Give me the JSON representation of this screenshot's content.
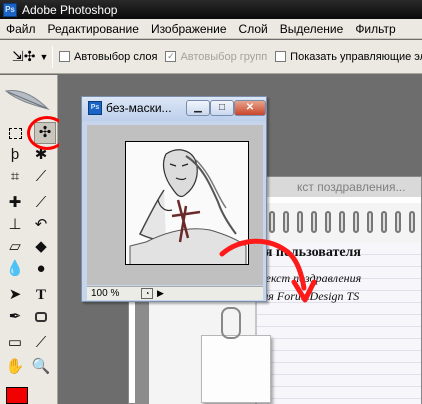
{
  "app": {
    "title": "Adobe Photoshop",
    "icon": "photoshop-app-icon"
  },
  "menu": {
    "items": [
      "Файл",
      "Редактирование",
      "Изображение",
      "Слой",
      "Выделение",
      "Фильтр"
    ]
  },
  "options_bar": {
    "tool_icon": "move-tool-icon",
    "dropdown_icon": "chevron-down-icon",
    "checkboxes": [
      {
        "label": "Автовыбор слоя",
        "checked": false,
        "enabled": true
      },
      {
        "label": "Автовыбор групп",
        "checked": true,
        "enabled": false
      },
      {
        "label": "Показать управляющие эле",
        "checked": false,
        "enabled": true
      }
    ]
  },
  "toolbox": {
    "tools": [
      "marquee-tool-icon",
      "move-tool-icon",
      "lasso-tool-icon",
      "magic-wand-tool-icon",
      "crop-tool-icon",
      "eyedropper-slice-tool-icon",
      "healing-brush-tool-icon",
      "brush-tool-icon",
      "clone-stamp-tool-icon",
      "history-brush-tool-icon",
      "eraser-tool-icon",
      "paint-bucket-tool-icon",
      "blur-tool-icon",
      "dodge-tool-icon",
      "path-selection-tool-icon",
      "type-tool-icon",
      "pen-tool-icon",
      "shape-tool-icon",
      "notes-tool-icon",
      "eyedropper-tool-icon",
      "hand-tool-icon",
      "zoom-tool-icon"
    ],
    "foreground_color": "#f20000"
  },
  "doc_small": {
    "title": "без-маски...",
    "zoom": "100 %",
    "buttons": [
      "minimize",
      "maximize",
      "close"
    ]
  },
  "doc_large": {
    "title": "кст поздравления..."
  },
  "notebook_text": {
    "line1": "ля пользователя",
    "line2": "текст поздравления",
    "line3": "для ForumDesign TS"
  },
  "highlight_color": "#ff0000"
}
